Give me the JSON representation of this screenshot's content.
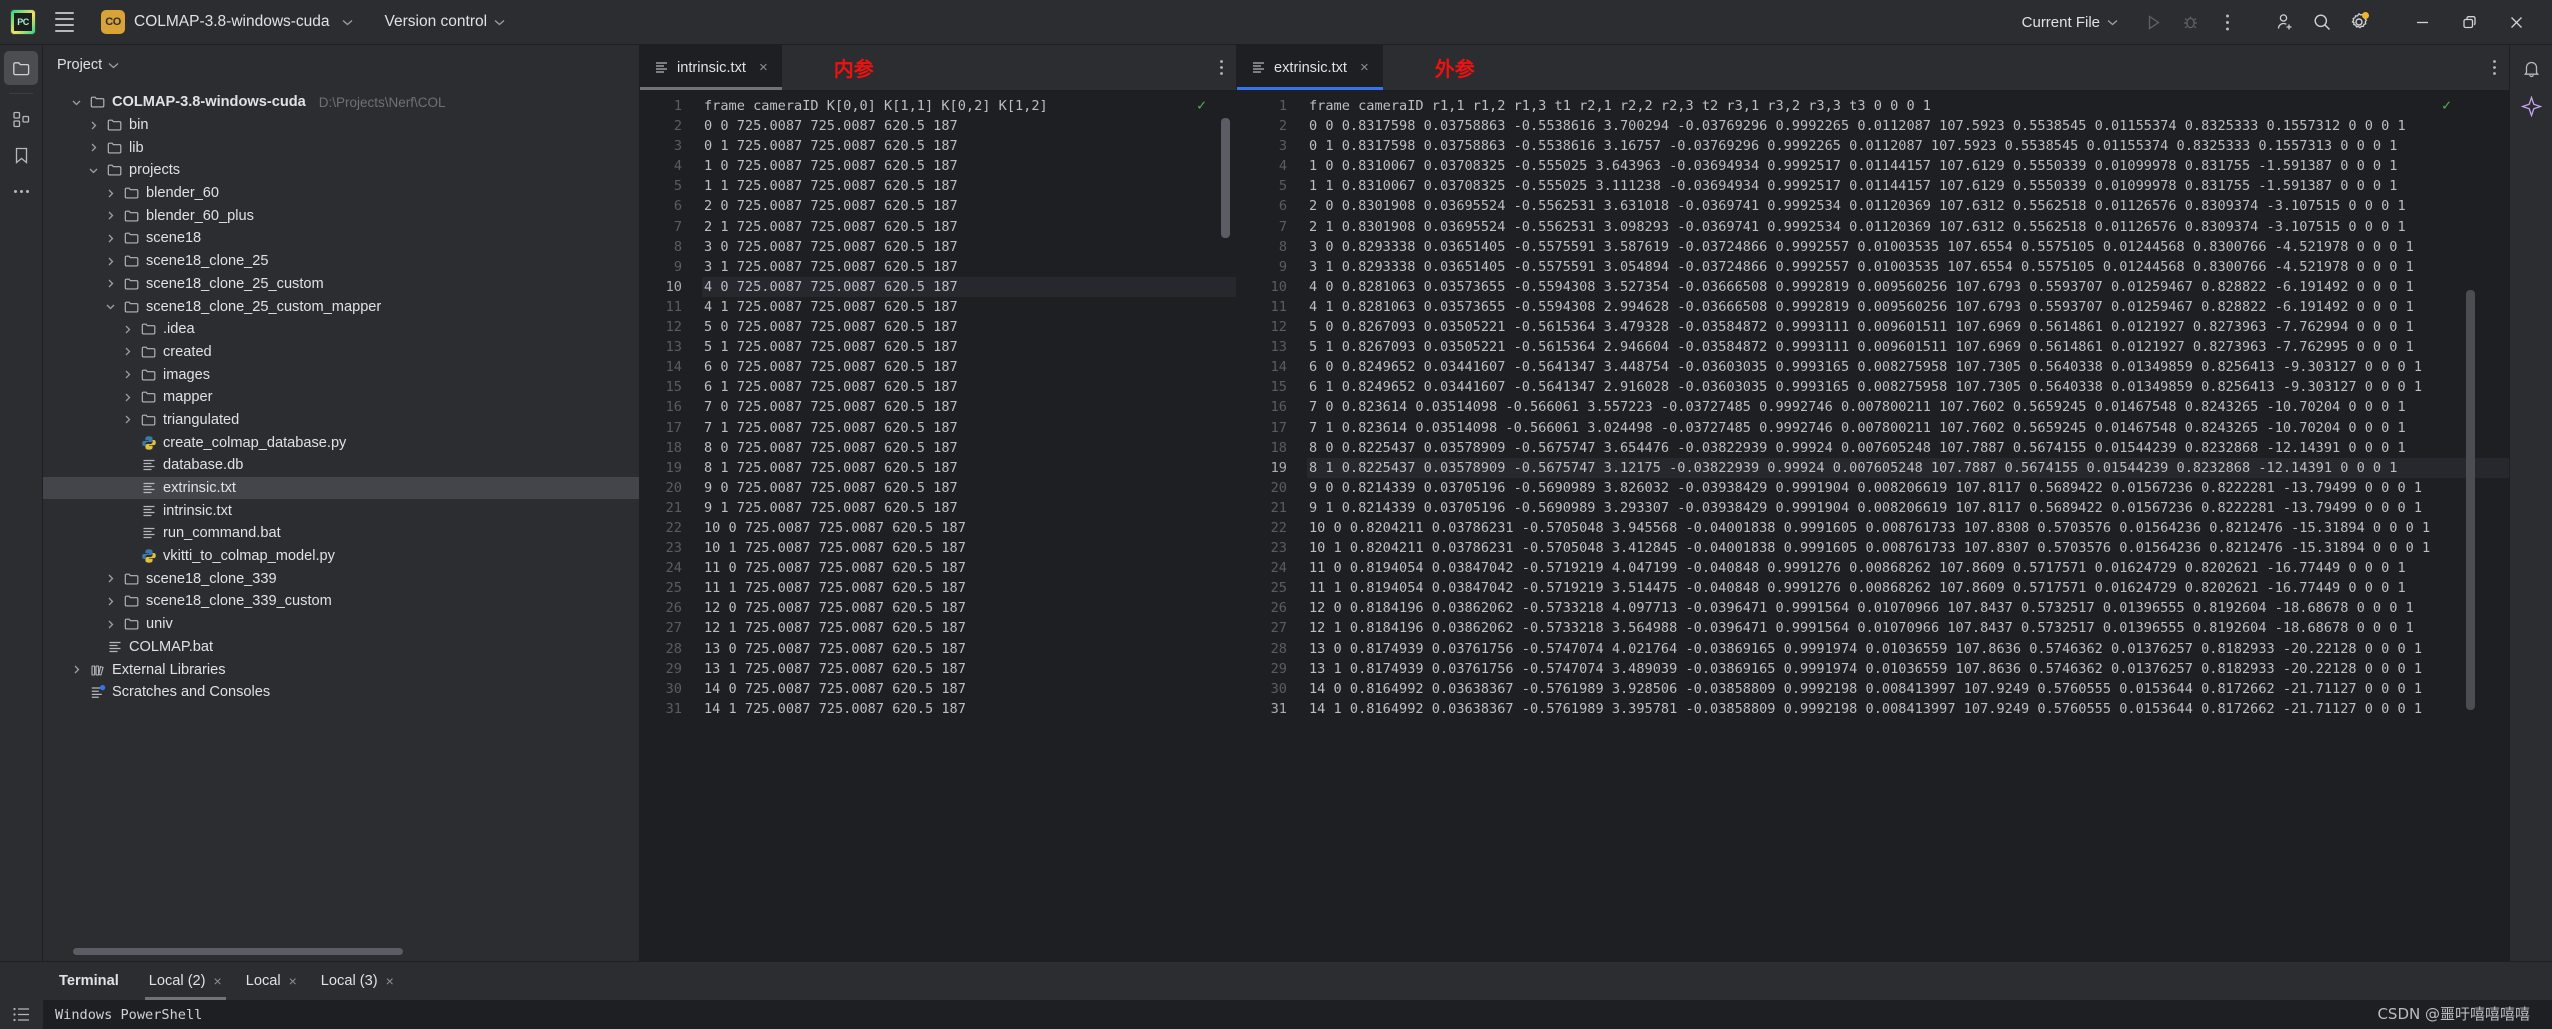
{
  "titlebar": {
    "menu_icon": "hamburger-icon",
    "app_logo": "pycharm-logo",
    "project_badge": "CO",
    "project_name": "COLMAP-3.8-windows-cuda",
    "version_control": "Version control",
    "run_config": "Current File",
    "icons": [
      "run-icon",
      "debug-icon",
      "more-options-icon",
      "add-user-icon",
      "search-icon",
      "settings-icon"
    ],
    "window_controls": [
      "minimize-icon",
      "restore-icon",
      "close-icon"
    ]
  },
  "rail": {
    "items": [
      "project-icon",
      "structure-icon",
      "bookmarks-icon",
      "more-tool-windows-icon"
    ],
    "bottom": [
      "terminal-icon"
    ]
  },
  "project_panel": {
    "title": "Project",
    "tree": [
      {
        "depth": 0,
        "twist": "down",
        "icon": "folder-icon",
        "label": "COLMAP-3.8-windows-cuda",
        "bold": true,
        "path": "D:\\Projects\\Nerf\\COL",
        "selected": false
      },
      {
        "depth": 1,
        "twist": "right",
        "icon": "folder-icon",
        "label": "bin",
        "selected": false
      },
      {
        "depth": 1,
        "twist": "right",
        "icon": "folder-icon",
        "label": "lib",
        "selected": false
      },
      {
        "depth": 1,
        "twist": "down",
        "icon": "folder-icon",
        "label": "projects",
        "selected": false
      },
      {
        "depth": 2,
        "twist": "right",
        "icon": "folder-icon",
        "label": "blender_60",
        "selected": false
      },
      {
        "depth": 2,
        "twist": "right",
        "icon": "folder-icon",
        "label": "blender_60_plus",
        "selected": false
      },
      {
        "depth": 2,
        "twist": "right",
        "icon": "folder-icon",
        "label": "scene18",
        "selected": false
      },
      {
        "depth": 2,
        "twist": "right",
        "icon": "folder-icon",
        "label": "scene18_clone_25",
        "selected": false
      },
      {
        "depth": 2,
        "twist": "right",
        "icon": "folder-icon",
        "label": "scene18_clone_25_custom",
        "selected": false
      },
      {
        "depth": 2,
        "twist": "down",
        "icon": "folder-icon",
        "label": "scene18_clone_25_custom_mapper",
        "selected": false
      },
      {
        "depth": 3,
        "twist": "right",
        "icon": "folder-icon",
        "label": ".idea",
        "selected": false
      },
      {
        "depth": 3,
        "twist": "right",
        "icon": "folder-icon",
        "label": "created",
        "selected": false
      },
      {
        "depth": 3,
        "twist": "right",
        "icon": "folder-icon",
        "label": "images",
        "selected": false
      },
      {
        "depth": 3,
        "twist": "right",
        "icon": "folder-icon",
        "label": "mapper",
        "selected": false
      },
      {
        "depth": 3,
        "twist": "right",
        "icon": "folder-icon",
        "label": "triangulated",
        "selected": false
      },
      {
        "depth": 3,
        "twist": "none",
        "icon": "python-file-icon",
        "label": "create_colmap_database.py",
        "selected": false
      },
      {
        "depth": 3,
        "twist": "none",
        "icon": "text-file-icon",
        "label": "database.db",
        "selected": false
      },
      {
        "depth": 3,
        "twist": "none",
        "icon": "text-file-icon",
        "label": "extrinsic.txt",
        "selected": true
      },
      {
        "depth": 3,
        "twist": "none",
        "icon": "text-file-icon",
        "label": "intrinsic.txt",
        "selected": false
      },
      {
        "depth": 3,
        "twist": "none",
        "icon": "text-file-icon",
        "label": "run_command.bat",
        "selected": false
      },
      {
        "depth": 3,
        "twist": "none",
        "icon": "python-file-icon",
        "label": "vkitti_to_colmap_model.py",
        "selected": false
      },
      {
        "depth": 2,
        "twist": "right",
        "icon": "folder-icon",
        "label": "scene18_clone_339",
        "selected": false
      },
      {
        "depth": 2,
        "twist": "right",
        "icon": "folder-icon",
        "label": "scene18_clone_339_custom",
        "selected": false
      },
      {
        "depth": 2,
        "twist": "right",
        "icon": "folder-icon",
        "label": "univ",
        "selected": false
      },
      {
        "depth": 1,
        "twist": "none",
        "icon": "text-file-icon",
        "label": "COLMAP.bat",
        "selected": false
      },
      {
        "depth": 0,
        "twist": "right",
        "icon": "library-icon",
        "label": "External Libraries",
        "selected": false
      },
      {
        "depth": 0,
        "twist": "none",
        "icon": "scratches-icon",
        "label": "Scratches and Consoles",
        "selected": false
      }
    ]
  },
  "editor_left": {
    "tab": {
      "label": "intrinsic.txt",
      "icon": "text-file-icon",
      "close": "×",
      "active": true
    },
    "annotation": "内参",
    "more_icon": "more-vertical-icon",
    "inspection_status": "✓",
    "lines": [
      {
        "n": 1,
        "text": "frame cameraID K[0,0] K[1,1] K[0,2] K[1,2]"
      },
      {
        "n": 2,
        "text": "0 0 725.0087 725.0087 620.5 187"
      },
      {
        "n": 3,
        "text": "0 1 725.0087 725.0087 620.5 187"
      },
      {
        "n": 4,
        "text": "1 0 725.0087 725.0087 620.5 187"
      },
      {
        "n": 5,
        "text": "1 1 725.0087 725.0087 620.5 187"
      },
      {
        "n": 6,
        "text": "2 0 725.0087 725.0087 620.5 187"
      },
      {
        "n": 7,
        "text": "2 1 725.0087 725.0087 620.5 187"
      },
      {
        "n": 8,
        "text": "3 0 725.0087 725.0087 620.5 187"
      },
      {
        "n": 9,
        "text": "3 1 725.0087 725.0087 620.5 187"
      },
      {
        "n": 10,
        "text": "4 0 725.0087 725.0087 620.5 187",
        "highlight": true
      },
      {
        "n": 11,
        "text": "4 1 725.0087 725.0087 620.5 187"
      },
      {
        "n": 12,
        "text": "5 0 725.0087 725.0087 620.5 187"
      },
      {
        "n": 13,
        "text": "5 1 725.0087 725.0087 620.5 187"
      },
      {
        "n": 14,
        "text": "6 0 725.0087 725.0087 620.5 187"
      },
      {
        "n": 15,
        "text": "6 1 725.0087 725.0087 620.5 187"
      },
      {
        "n": 16,
        "text": "7 0 725.0087 725.0087 620.5 187"
      },
      {
        "n": 17,
        "text": "7 1 725.0087 725.0087 620.5 187"
      },
      {
        "n": 18,
        "text": "8 0 725.0087 725.0087 620.5 187"
      },
      {
        "n": 19,
        "text": "8 1 725.0087 725.0087 620.5 187"
      },
      {
        "n": 20,
        "text": "9 0 725.0087 725.0087 620.5 187"
      },
      {
        "n": 21,
        "text": "9 1 725.0087 725.0087 620.5 187"
      },
      {
        "n": 22,
        "text": "10 0 725.0087 725.0087 620.5 187"
      },
      {
        "n": 23,
        "text": "10 1 725.0087 725.0087 620.5 187"
      },
      {
        "n": 24,
        "text": "11 0 725.0087 725.0087 620.5 187"
      },
      {
        "n": 25,
        "text": "11 1 725.0087 725.0087 620.5 187"
      },
      {
        "n": 26,
        "text": "12 0 725.0087 725.0087 620.5 187"
      },
      {
        "n": 27,
        "text": "12 1 725.0087 725.0087 620.5 187"
      },
      {
        "n": 28,
        "text": "13 0 725.0087 725.0087 620.5 187"
      },
      {
        "n": 29,
        "text": "13 1 725.0087 725.0087 620.5 187"
      },
      {
        "n": 30,
        "text": "14 0 725.0087 725.0087 620.5 187"
      },
      {
        "n": 31,
        "text": "14 1 725.0087 725.0087 620.5 187"
      }
    ]
  },
  "editor_right": {
    "tab": {
      "label": "extrinsic.txt",
      "icon": "text-file-icon",
      "close": "×",
      "active": true
    },
    "annotation": "外参",
    "more_icon": "more-vertical-icon",
    "inspection_status": "✓",
    "lines": [
      {
        "n": 1,
        "text": "frame cameraID r1,1 r1,2 r1,3 t1 r2,1 r2,2 r2,3 t2 r3,1 r3,2 r3,3 t3 0 0 0 1"
      },
      {
        "n": 2,
        "text": "0 0 0.8317598 0.03758863 -0.5538616 3.700294 -0.03769296 0.9992265 0.0112087 107.5923 0.5538545 0.01155374 0.8325333 0.1557312 0 0 0 1"
      },
      {
        "n": 3,
        "text": "0 1 0.8317598 0.03758863 -0.5538616 3.16757 -0.03769296 0.9992265 0.0112087 107.5923 0.5538545 0.01155374 0.8325333 0.1557313 0 0 0 1"
      },
      {
        "n": 4,
        "text": "1 0 0.8310067 0.03708325 -0.555025 3.643963 -0.03694934 0.9992517 0.01144157 107.6129 0.5550339 0.01099978 0.831755 -1.591387 0 0 0 1"
      },
      {
        "n": 5,
        "text": "1 1 0.8310067 0.03708325 -0.555025 3.111238 -0.03694934 0.9992517 0.01144157 107.6129 0.5550339 0.01099978 0.831755 -1.591387 0 0 0 1"
      },
      {
        "n": 6,
        "text": "2 0 0.8301908 0.03695524 -0.5562531 3.631018 -0.0369741 0.9992534 0.01120369 107.6312 0.5562518 0.01126576 0.8309374 -3.107515 0 0 0 1"
      },
      {
        "n": 7,
        "text": "2 1 0.8301908 0.03695524 -0.5562531 3.098293 -0.0369741 0.9992534 0.01120369 107.6312 0.5562518 0.01126576 0.8309374 -3.107515 0 0 0 1"
      },
      {
        "n": 8,
        "text": "3 0 0.8293338 0.03651405 -0.5575591 3.587619 -0.03724866 0.9992557 0.01003535 107.6554 0.5575105 0.01244568 0.8300766 -4.521978 0 0 0 1"
      },
      {
        "n": 9,
        "text": "3 1 0.8293338 0.03651405 -0.5575591 3.054894 -0.03724866 0.9992557 0.01003535 107.6554 0.5575105 0.01244568 0.8300766 -4.521978 0 0 0 1"
      },
      {
        "n": 10,
        "text": "4 0 0.8281063 0.03573655 -0.5594308 3.527354 -0.03666508 0.9992819 0.009560256 107.6793 0.5593707 0.01259467 0.828822 -6.191492 0 0 0 1"
      },
      {
        "n": 11,
        "text": "4 1 0.8281063 0.03573655 -0.5594308 2.994628 -0.03666508 0.9992819 0.009560256 107.6793 0.5593707 0.01259467 0.828822 -6.191492 0 0 0 1"
      },
      {
        "n": 12,
        "text": "5 0 0.8267093 0.03505221 -0.5615364 3.479328 -0.03584872 0.9993111 0.009601511 107.6969 0.5614861 0.0121927 0.8273963 -7.762994 0 0 0 1"
      },
      {
        "n": 13,
        "text": "5 1 0.8267093 0.03505221 -0.5615364 2.946604 -0.03584872 0.9993111 0.009601511 107.6969 0.5614861 0.0121927 0.8273963 -7.762995 0 0 0 1"
      },
      {
        "n": 14,
        "text": "6 0 0.8249652 0.03441607 -0.5641347 3.448754 -0.03603035 0.9993165 0.008275958 107.7305 0.5640338 0.01349859 0.8256413 -9.303127 0 0 0 1"
      },
      {
        "n": 15,
        "text": "6 1 0.8249652 0.03441607 -0.5641347 2.916028 -0.03603035 0.9993165 0.008275958 107.7305 0.5640338 0.01349859 0.8256413 -9.303127 0 0 0 1"
      },
      {
        "n": 16,
        "text": "7 0 0.823614 0.03514098 -0.566061 3.557223 -0.03727485 0.9992746 0.007800211 107.7602 0.5659245 0.01467548 0.8243265 -10.70204 0 0 0 1"
      },
      {
        "n": 17,
        "text": "7 1 0.823614 0.03514098 -0.566061 3.024498 -0.03727485 0.9992746 0.007800211 107.7602 0.5659245 0.01467548 0.8243265 -10.70204 0 0 0 1"
      },
      {
        "n": 18,
        "text": "8 0 0.8225437 0.03578909 -0.5675747 3.654476 -0.03822939 0.99924 0.007605248 107.7887 0.5674155 0.01544239 0.8232868 -12.14391 0 0 0 1"
      },
      {
        "n": 19,
        "text": "8 1 0.8225437 0.03578909 -0.5675747 3.12175 -0.03822939 0.99924 0.007605248 107.7887 0.5674155 0.01544239 0.8232868 -12.14391 0 0 0 1",
        "highlight": true
      },
      {
        "n": 20,
        "text": "9 0 0.8214339 0.03705196 -0.5690989 3.826032 -0.03938429 0.9991904 0.008206619 107.8117 0.5689422 0.01567236 0.8222281 -13.79499 0 0 0 1"
      },
      {
        "n": 21,
        "text": "9 1 0.8214339 0.03705196 -0.5690989 3.293307 -0.03938429 0.9991904 0.008206619 107.8117 0.5689422 0.01567236 0.8222281 -13.79499 0 0 0 1"
      },
      {
        "n": 22,
        "text": "10 0 0.8204211 0.03786231 -0.5705048 3.945568 -0.04001838 0.9991605 0.008761733 107.8308 0.5703576 0.01564236 0.8212476 -15.31894 0 0 0 1"
      },
      {
        "n": 23,
        "text": "10 1 0.8204211 0.03786231 -0.5705048 3.412845 -0.04001838 0.9991605 0.008761733 107.8307 0.5703576 0.01564236 0.8212476 -15.31894 0 0 0 1"
      },
      {
        "n": 24,
        "text": "11 0 0.8194054 0.03847042 -0.5719219 4.047199 -0.040848 0.9991276 0.00868262 107.8609 0.5717571 0.01624729 0.8202621 -16.77449 0 0 0 1"
      },
      {
        "n": 25,
        "text": "11 1 0.8194054 0.03847042 -0.5719219 3.514475 -0.040848 0.9991276 0.00868262 107.8609 0.5717571 0.01624729 0.8202621 -16.77449 0 0 0 1"
      },
      {
        "n": 26,
        "text": "12 0 0.8184196 0.03862062 -0.5733218 4.097713 -0.0396471 0.9991564 0.01070966 107.8437 0.5732517 0.01396555 0.8192604 -18.68678 0 0 0 1"
      },
      {
        "n": 27,
        "text": "12 1 0.8184196 0.03862062 -0.5733218 3.564988 -0.0396471 0.9991564 0.01070966 107.8437 0.5732517 0.01396555 0.8192604 -18.68678 0 0 0 1"
      },
      {
        "n": 28,
        "text": "13 0 0.8174939 0.03761756 -0.5747074 4.021764 -0.03869165 0.9991974 0.01036559 107.8636 0.5746362 0.01376257 0.8182933 -20.22128 0 0 0 1"
      },
      {
        "n": 29,
        "text": "13 1 0.8174939 0.03761756 -0.5747074 3.489039 -0.03869165 0.9991974 0.01036559 107.8636 0.5746362 0.01376257 0.8182933 -20.22128 0 0 0 1"
      },
      {
        "n": 30,
        "text": "14 0 0.8164992 0.03638367 -0.5761989 3.928506 -0.03858809 0.9992198 0.008413997 107.9249 0.5760555 0.0153644 0.8172662 -21.71127 0 0 0 1"
      },
      {
        "n": 31,
        "text": "14 1 0.8164992 0.03638367 -0.5761989 3.395781 -0.03858809 0.9992198 0.008413997 107.9249 0.5760555 0.0153644 0.8172662 -21.71127 0 0 0 1",
        "selected": true
      }
    ]
  },
  "right_rail": {
    "items": [
      "notifications-icon",
      "ai-assistant-icon"
    ]
  },
  "bottom": {
    "terminal_title": "Terminal",
    "tabs": [
      {
        "label": "Local (2)",
        "close": "×",
        "active": true
      },
      {
        "label": "Local",
        "close": "×",
        "active": false
      },
      {
        "label": "Local (3)",
        "close": "×",
        "active": false
      }
    ],
    "rail_icon": "terminal-list-icon",
    "output": "Windows PowerShell"
  },
  "watermark": "CSDN @噩吁嘻嘻嘻嘻",
  "colors": {
    "bg": "#2b2d30",
    "editor_bg": "#1e1f22",
    "accent_blue": "#3573f0",
    "accent_orange": "#d9a336",
    "annotation_red": "#ee1111",
    "check_green": "#4caf50",
    "text": "#dfe1e5"
  }
}
